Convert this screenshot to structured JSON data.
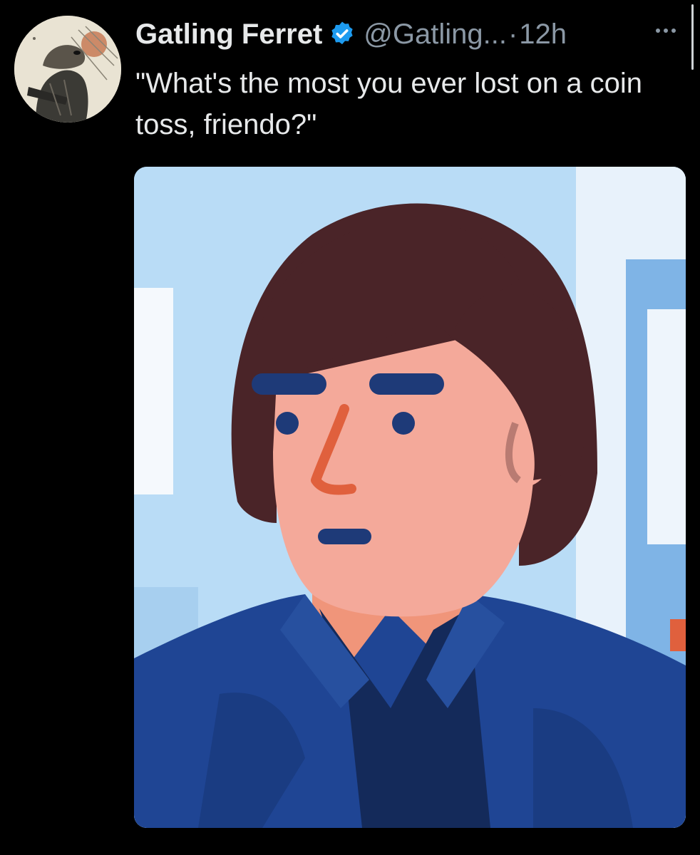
{
  "tweet": {
    "author": {
      "display_name": "Gatling Ferret",
      "handle": "@Gatling...",
      "verified_icon": "verified-badge-icon",
      "avatar_icon": "ferret-avatar"
    },
    "separator": "·",
    "time": "12h",
    "more_icon": "more-horizontal-icon",
    "text": "\"What's the most you ever lost on a coin toss, friendo?\"",
    "media": {
      "kind": "illustration",
      "subject": "cartoon man with bowl haircut in blue jacket"
    }
  },
  "colors": {
    "background": "#000000",
    "text": "#e7e9ea",
    "muted": "#8b98a5",
    "verified": "#1d9bf0",
    "hair": "#4a2428",
    "skin": "#f4a99a",
    "jacket": "#1f4594",
    "sky": "#b9dcf6"
  }
}
